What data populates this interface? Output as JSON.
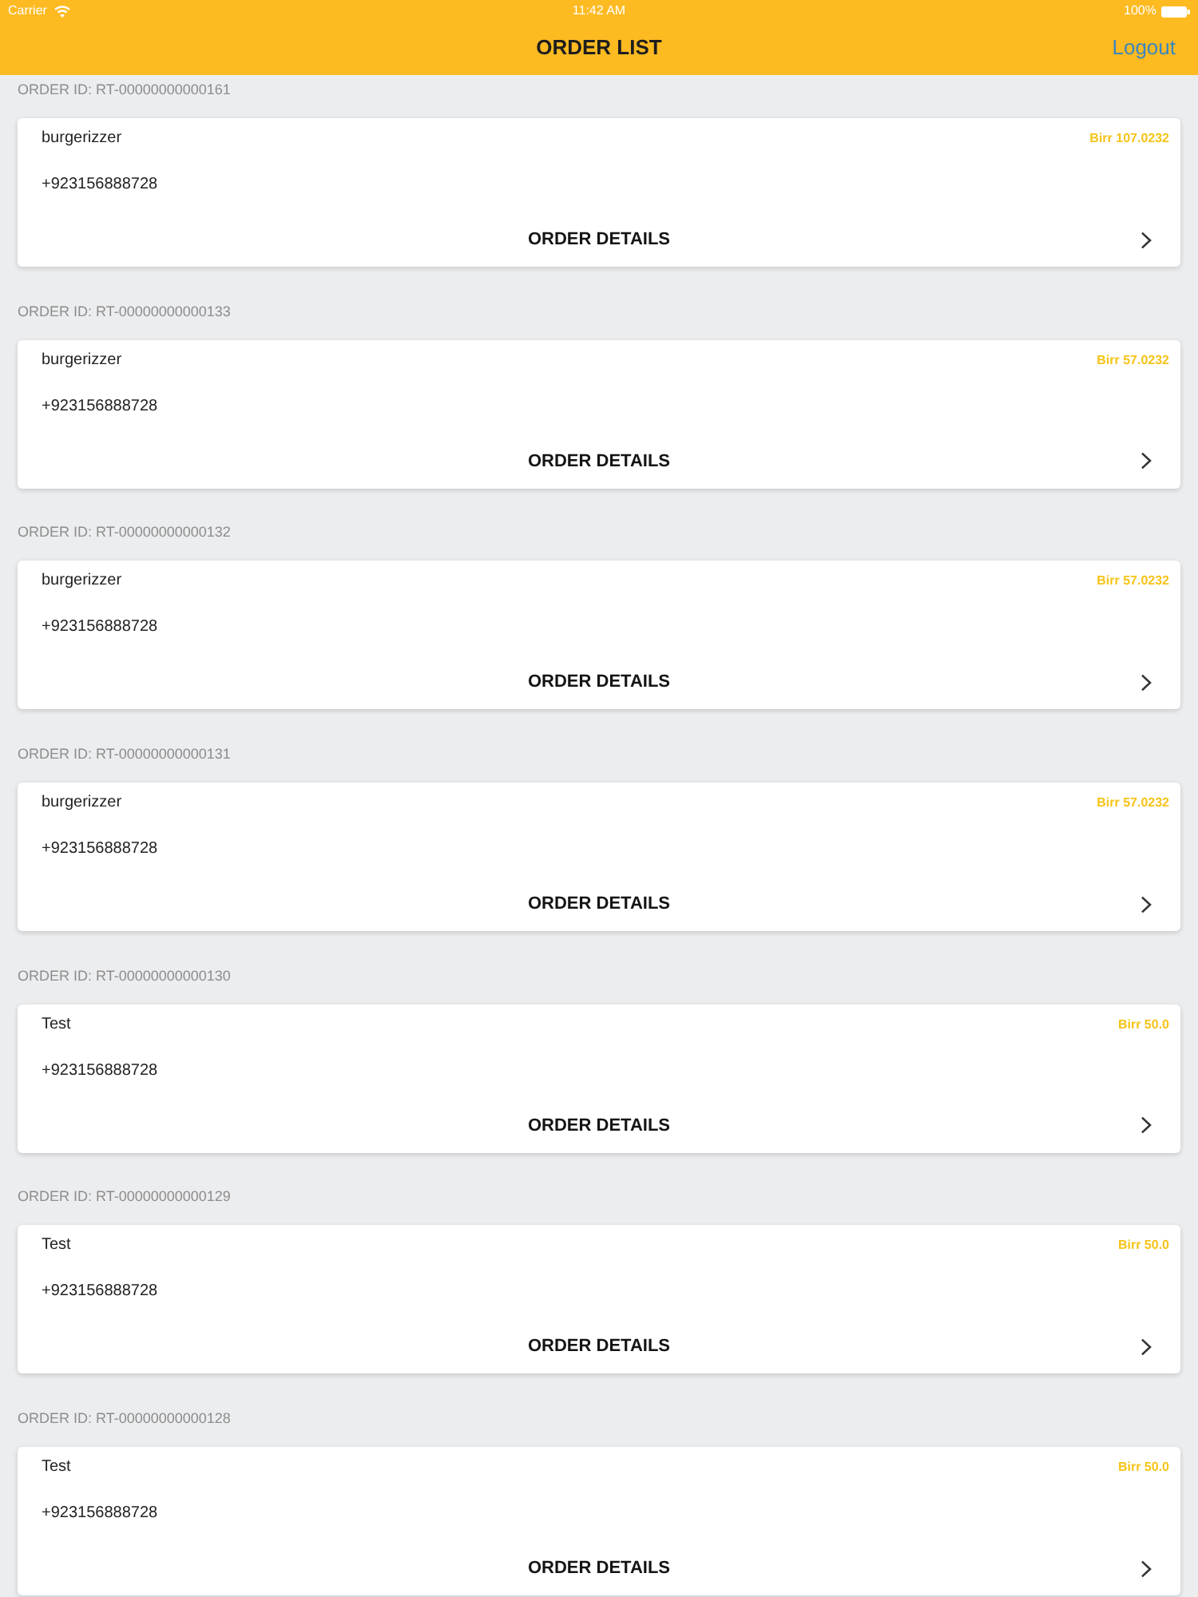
{
  "status_bar": {
    "carrier": "Carrier",
    "time": "11:42 AM",
    "battery": "100%"
  },
  "nav_bar": {
    "title": "ORDER LIST",
    "action": "Logout"
  },
  "orders": [
    {
      "order_id": "ORDER ID: RT-00000000000161",
      "customer": "burgerizzer",
      "total": "Birr 107.0232",
      "phone": "+923156888728",
      "details_button": "ORDER DETAILS"
    },
    {
      "order_id": "ORDER ID: RT-00000000000133",
      "customer": "burgerizzer",
      "total": "Birr 57.0232",
      "phone": "+923156888728",
      "details_button": "ORDER DETAILS"
    },
    {
      "order_id": "ORDER ID: RT-00000000000132",
      "customer": "burgerizzer",
      "total": "Birr 57.0232",
      "phone": "+923156888728",
      "details_button": "ORDER DETAILS"
    },
    {
      "order_id": "ORDER ID: RT-00000000000131",
      "customer": "burgerizzer",
      "total": "Birr 57.0232",
      "phone": "+923156888728",
      "details_button": "ORDER DETAILS"
    },
    {
      "order_id": "ORDER ID: RT-00000000000130",
      "customer": "Test",
      "total": "Birr 50.0",
      "phone": "+923156888728",
      "details_button": "ORDER DETAILS"
    },
    {
      "order_id": "ORDER ID: RT-00000000000129",
      "customer": "Test",
      "total": "Birr 50.0",
      "phone": "+923156888728",
      "details_button": "ORDER DETAILS"
    },
    {
      "order_id": "ORDER ID: RT-00000000000128",
      "customer": "Test",
      "total": "Birr 50.0",
      "phone": "+923156888728",
      "details_button": "ORDER DETAILS"
    }
  ]
}
